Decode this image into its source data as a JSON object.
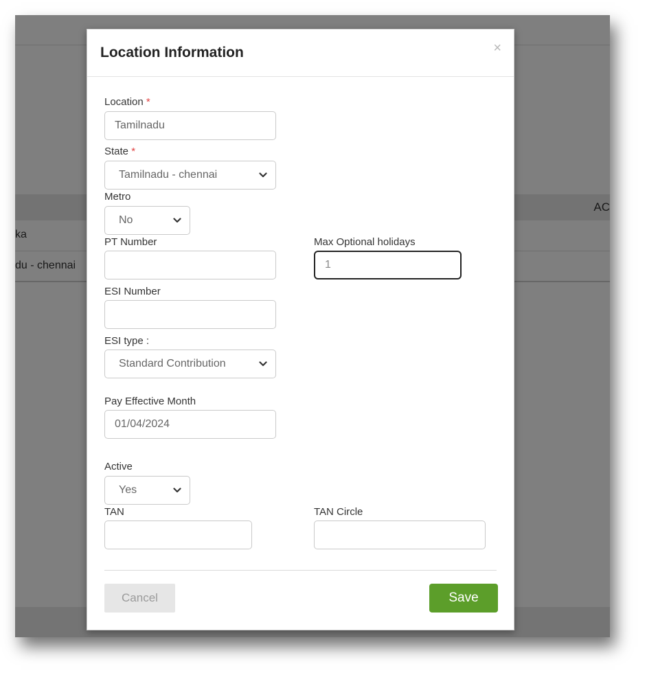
{
  "background": {
    "table_header_action": "AC",
    "rows": [
      "ka",
      "du - chennai"
    ]
  },
  "modal": {
    "title": "Location Information",
    "close_glyph": "×",
    "required_mark": "*",
    "location": {
      "label": "Location",
      "value": "Tamilnadu"
    },
    "state": {
      "label": "State",
      "value": "Tamilnadu - chennai"
    },
    "metro": {
      "label": "Metro",
      "value": "No"
    },
    "pt_number": {
      "label": "PT Number",
      "value": ""
    },
    "max_optional_holidays": {
      "label": "Max Optional holidays",
      "value": "1"
    },
    "esi_number": {
      "label": "ESI Number",
      "value": ""
    },
    "esi_type": {
      "label": "ESI type :",
      "value": "Standard Contribution"
    },
    "pay_effective_month": {
      "label": "Pay Effective Month",
      "value": "01/04/2024"
    },
    "active": {
      "label": "Active",
      "value": "Yes"
    },
    "tan": {
      "label": "TAN",
      "value": ""
    },
    "tan_circle": {
      "label": "TAN Circle",
      "value": ""
    },
    "cancel_label": "Cancel",
    "save_label": "Save"
  },
  "colors": {
    "save_button": "#5c9e2a",
    "required": "#e04040",
    "overlay": "rgba(0,0,0,0.5)"
  },
  "icons": {
    "dropdown": "chevron-down-icon",
    "close": "close-icon"
  }
}
